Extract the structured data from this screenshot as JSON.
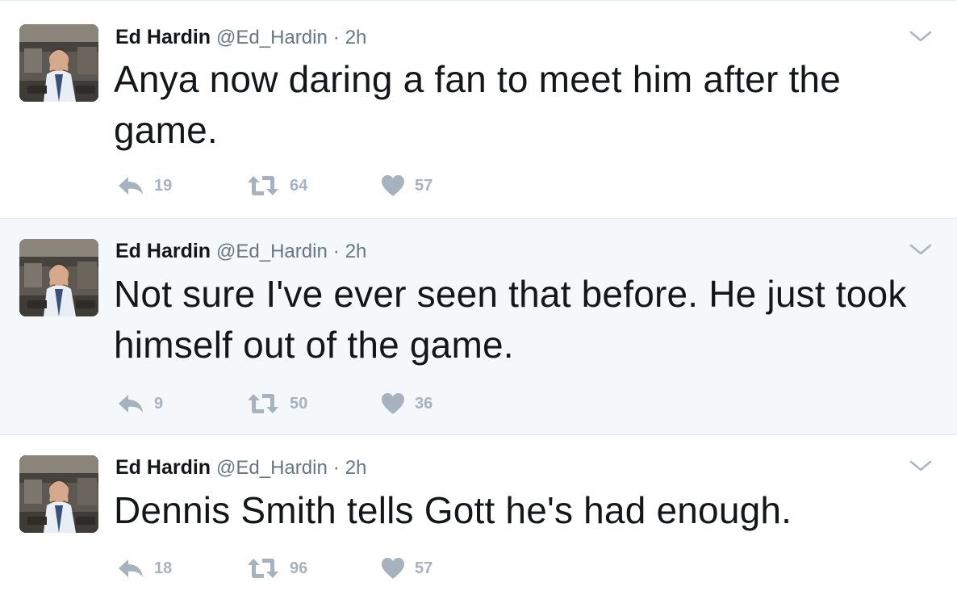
{
  "tweets": [
    {
      "author": {
        "name": "Ed Hardin",
        "handle": "@Ed_Hardin"
      },
      "separator": "·",
      "time": "2h",
      "text": "Anya now daring a fan to meet him after the game.",
      "counts": {
        "replies": "19",
        "retweets": "64",
        "likes": "57"
      }
    },
    {
      "author": {
        "name": "Ed Hardin",
        "handle": "@Ed_Hardin"
      },
      "separator": "·",
      "time": "2h",
      "text": "Not sure I've ever seen that before. He just took himself out of the game.",
      "counts": {
        "replies": "9",
        "retweets": "50",
        "likes": "36"
      }
    },
    {
      "author": {
        "name": "Ed Hardin",
        "handle": "@Ed_Hardin"
      },
      "separator": "·",
      "time": "2h",
      "text": "Dennis Smith tells Gott he's had enough.",
      "counts": {
        "replies": "18",
        "retweets": "96",
        "likes": "57"
      }
    }
  ],
  "icons": {
    "reply": "reply-icon",
    "retweet": "retweet-icon",
    "like": "heart-icon",
    "menu": "chevron-down-icon"
  },
  "colors": {
    "text": "#14171a",
    "secondary": "#657786",
    "action": "#a6b3be",
    "highlight_bg": "#f5f8fa",
    "border": "#e1e8ed"
  }
}
